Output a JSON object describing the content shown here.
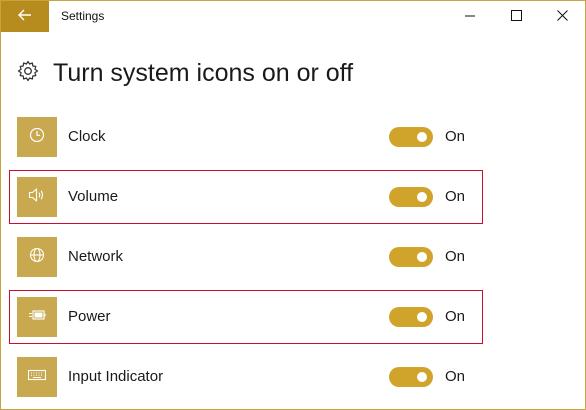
{
  "window": {
    "title": "Settings"
  },
  "page": {
    "title": "Turn system icons on or off"
  },
  "items": [
    {
      "label": "Clock",
      "state": "On",
      "icon": "clock-icon",
      "on": true
    },
    {
      "label": "Volume",
      "state": "On",
      "icon": "volume-icon",
      "on": true,
      "highlighted": true
    },
    {
      "label": "Network",
      "state": "On",
      "icon": "network-icon",
      "on": true
    },
    {
      "label": "Power",
      "state": "On",
      "icon": "power-icon",
      "on": true,
      "highlighted": true
    },
    {
      "label": "Input Indicator",
      "state": "On",
      "icon": "keyboard-icon",
      "on": true
    }
  ],
  "colors": {
    "accent": "#b68c1f",
    "tile": "#c9a94f",
    "toggle_on": "#d0a42b",
    "highlight_border": "#c8102e"
  }
}
